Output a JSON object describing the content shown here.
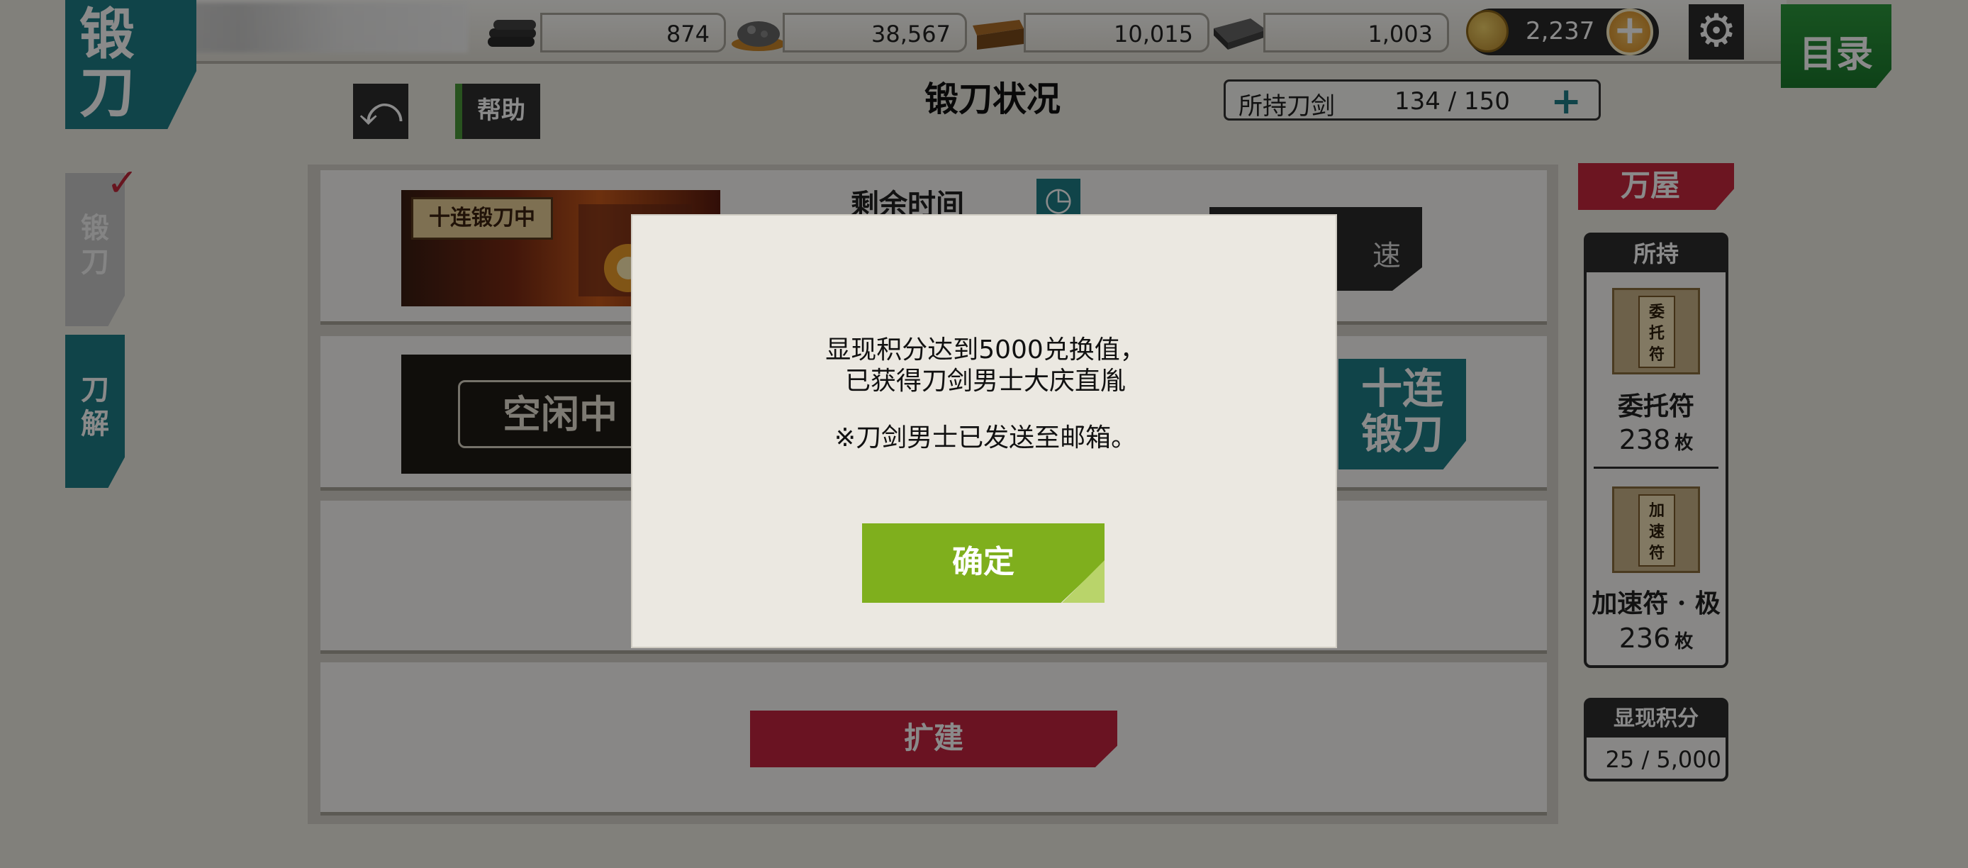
{
  "header": {
    "title_char1": "锻",
    "title_char2": "刀",
    "page_title": "锻刀状况",
    "help_label": "帮助",
    "menu_label": "目录"
  },
  "resources": [
    {
      "icon": "charcoal-icon",
      "value": "874"
    },
    {
      "icon": "jade-steel-icon",
      "value": "38,567"
    },
    {
      "icon": "cooling-material-icon",
      "value": "10,015"
    },
    {
      "icon": "whetstone-icon",
      "value": "1,003"
    }
  ],
  "coins": {
    "value": "2,237",
    "plus": "+"
  },
  "swords": {
    "label": "所持刀剑",
    "count": "134 / 150",
    "plus": "+"
  },
  "tabs": {
    "forge": "锻\n刀",
    "dismantle": "刀\n解"
  },
  "slots": {
    "slot1_sign": "十连锻刀中",
    "remaining_time_label": "剩余时间",
    "speed_label": "速",
    "slot2_status": "空闲中",
    "ten_forge_label": "十连\n锻刀",
    "expand_label": "扩建"
  },
  "shop": {
    "label": "万屋",
    "owned_header": "所持",
    "items": [
      {
        "ticket_text": "委\n托\n符",
        "name": "委托符",
        "count": "238",
        "unit": "枚"
      },
      {
        "ticket_text": "加\n速\n符",
        "name": "加速符 · 极",
        "count": "236",
        "unit": "枚"
      }
    ]
  },
  "points": {
    "label": "显现积分",
    "value": "25 / 5,000"
  },
  "dialog": {
    "line1": "显现积分达到5000兑换值，",
    "line2": "已获得刀剑男士大庆直胤",
    "line3": "※刀剑男士已发送至邮箱。",
    "ok_label": "确定"
  },
  "colors": {
    "teal": "#1f7f87",
    "red": "#c8283d",
    "green_menu": "#1b7a2d",
    "ok_green": "#7faf1d"
  }
}
